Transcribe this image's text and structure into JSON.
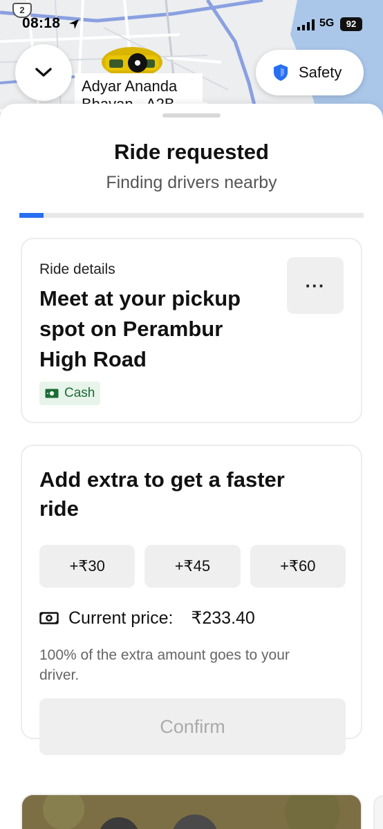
{
  "status_bar": {
    "route_number": "2",
    "time": "08:18",
    "network": "5G",
    "battery": "92"
  },
  "map": {
    "place_label": "Adyar Ananda Bhavan - A2B"
  },
  "safety_button": {
    "label": "Safety"
  },
  "sheet": {
    "title": "Ride requested",
    "subtitle": "Finding drivers nearby",
    "progress": 0.07
  },
  "ride_details": {
    "label": "Ride details",
    "headline": "Meet at your pickup spot on Perambur High Road",
    "more_label": "···",
    "payment": "Cash"
  },
  "extra": {
    "headline": "Add extra to get a faster ride",
    "options": [
      "+₹30",
      "+₹45",
      "+₹60"
    ],
    "current_price_label": "Current price:",
    "current_price_value": "₹233.40",
    "note": "100% of the extra amount goes to your driver.",
    "confirm_label": "Confirm"
  },
  "colors": {
    "accent": "#276ef1",
    "cash_green": "#1b6b34",
    "water": "#aac7ea"
  },
  "icons": {
    "collapse": "chevron-down-icon",
    "safety": "shield-icon",
    "cash": "banknote-icon",
    "price": "banknote-icon"
  }
}
